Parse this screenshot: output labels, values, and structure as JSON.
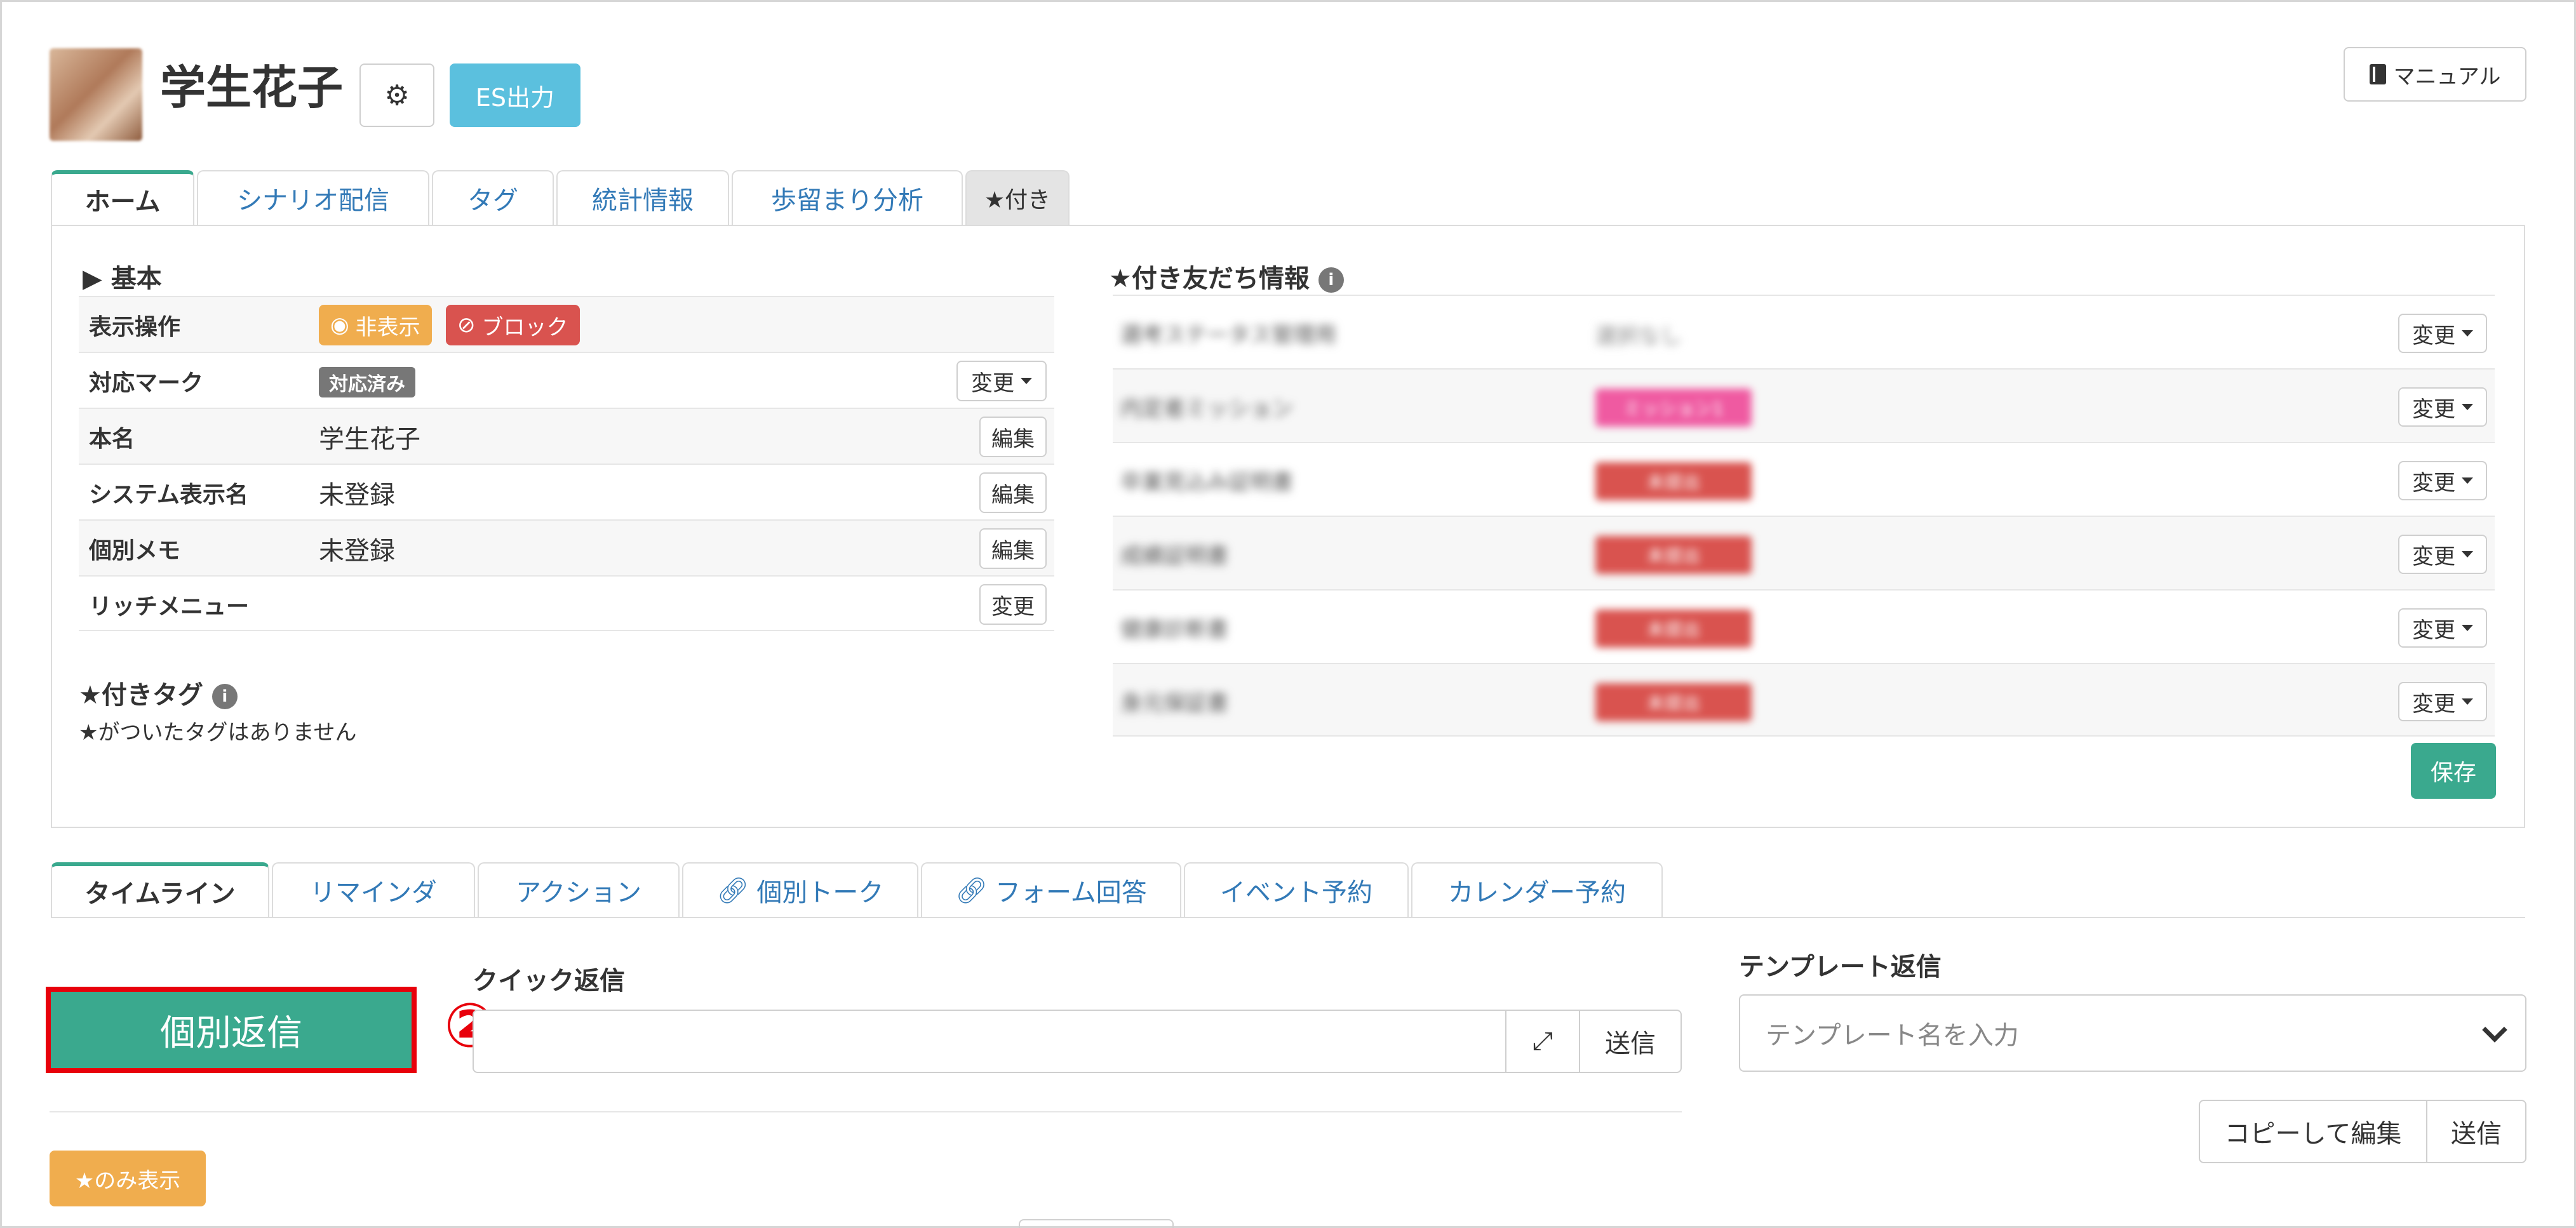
{
  "header": {
    "user_name": "学生花子",
    "es_button": "ES出力",
    "manual_button": "マニュアル"
  },
  "top_tabs": [
    {
      "label": "ホーム",
      "active": true
    },
    {
      "label": "シナリオ配信"
    },
    {
      "label": "タグ"
    },
    {
      "label": "統計情報"
    },
    {
      "label": "歩留まり分析"
    },
    {
      "label": "★付き"
    }
  ],
  "basic": {
    "title": "▶ 基本",
    "rows": {
      "display": {
        "label": "表示操作",
        "hide_button": "非表示",
        "block_button": "ブロック"
      },
      "mark": {
        "label": "対応マーク",
        "badge": "対応済み",
        "change_button": "変更"
      },
      "real_name": {
        "label": "本名",
        "value": "学生花子",
        "edit_button": "編集"
      },
      "system_name": {
        "label": "システム表示名",
        "value": "未登録",
        "edit_button": "編集"
      },
      "memo": {
        "label": "個別メモ",
        "value": "未登録",
        "edit_button": "編集"
      },
      "rich_menu": {
        "label": "リッチメニュー",
        "change_button": "変更"
      }
    }
  },
  "star_tags": {
    "title": "★付きタグ",
    "empty_text": "★がついたタグはありません"
  },
  "star_friend_info": {
    "title": "★付き友だち情報",
    "rows": [
      {
        "label": "選考ステータス管理用",
        "value": "選択なし",
        "badge": null,
        "change_button": "変更"
      },
      {
        "label": "内定者ミッション",
        "value": null,
        "badge": "ミッション1",
        "badge_color": "#ef5aa1",
        "change_button": "変更"
      },
      {
        "label": "卒業見込み証明書",
        "value": null,
        "badge": "未提出",
        "badge_color": "#d9534f",
        "change_button": "変更"
      },
      {
        "label": "成績証明書",
        "value": null,
        "badge": "未提出",
        "badge_color": "#d9534f",
        "change_button": "変更"
      },
      {
        "label": "健康診断書",
        "value": null,
        "badge": "未提出",
        "badge_color": "#d9534f",
        "change_button": "変更"
      },
      {
        "label": "身元保証書",
        "value": null,
        "badge": "未提出",
        "badge_color": "#d9534f",
        "change_button": "変更"
      }
    ],
    "save_button": "保存"
  },
  "bottom_tabs": [
    {
      "label": "タイムライン",
      "active": true
    },
    {
      "label": "リマインダ"
    },
    {
      "label": "アクション"
    },
    {
      "label": "個別トーク",
      "icon": "link-icon"
    },
    {
      "label": "フォーム回答",
      "icon": "link-icon"
    },
    {
      "label": "イベント予約"
    },
    {
      "label": "カレンダー予約"
    }
  ],
  "timeline": {
    "reply_button": "個別返信",
    "step_marker": "②",
    "quick_reply": {
      "label": "クイック返信",
      "placeholder": "",
      "send_button": "送信"
    },
    "template_reply": {
      "label": "テンプレート返信",
      "placeholder": "テンプレート名を入力",
      "copy_edit_button": "コピーして編集",
      "send_button": "送信"
    },
    "star_only_button": "★のみ表示"
  },
  "colors": {
    "primary_green": "#3aa98e",
    "info_blue": "#5bc0de",
    "warning_orange": "#f0ad4e",
    "danger_red": "#d9534f",
    "highlight_red": "#e8000b",
    "link_blue": "#337ab7"
  }
}
